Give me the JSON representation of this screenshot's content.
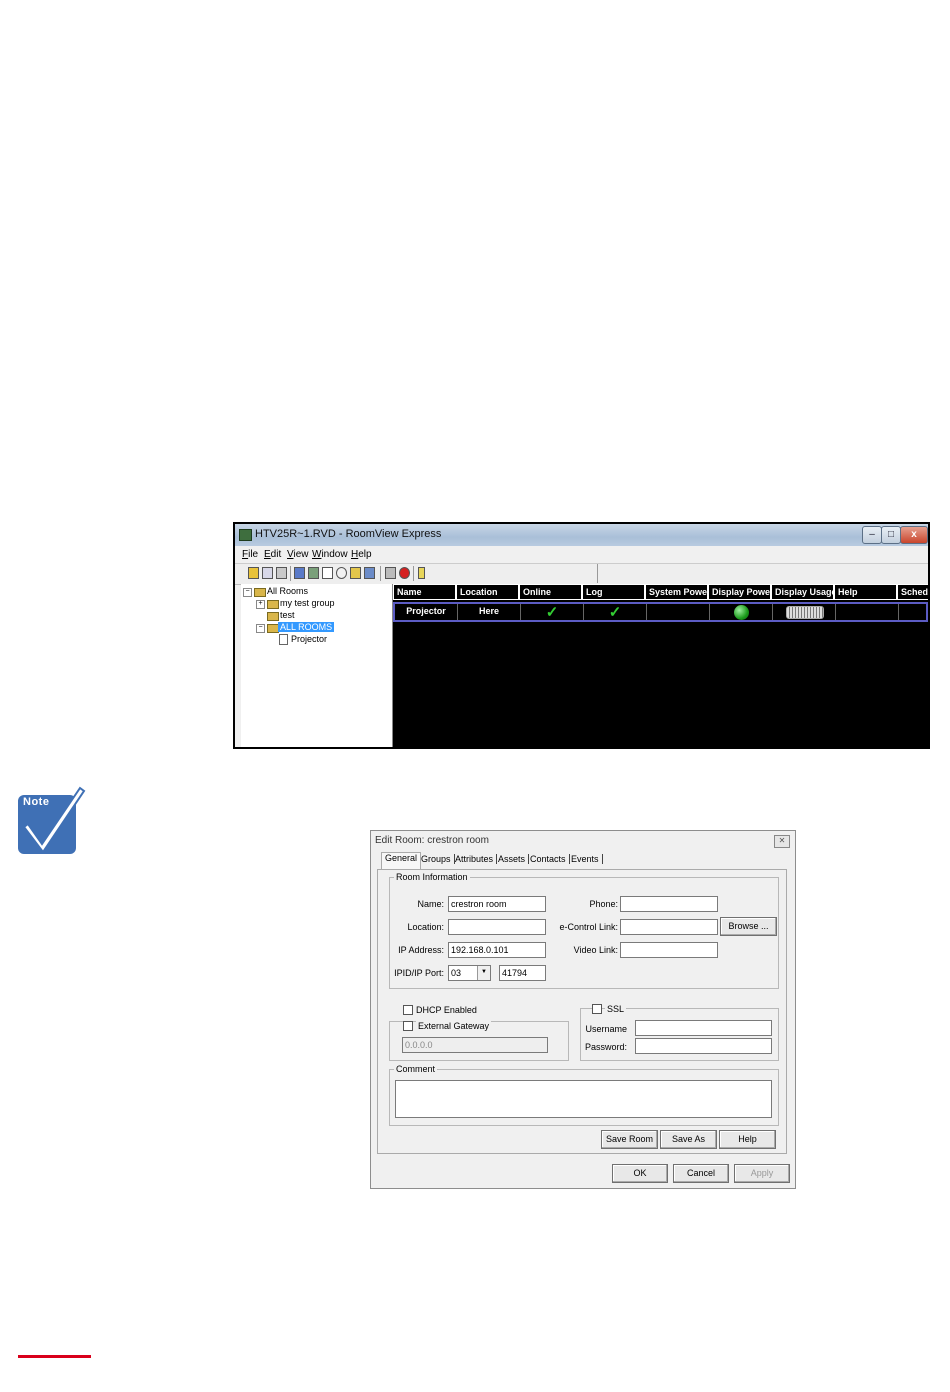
{
  "roomview": {
    "title": "HTV25R~1.RVD - RoomView Express",
    "menu": [
      "File",
      "Edit",
      "View",
      "Window",
      "Help"
    ],
    "tree": {
      "root": "All Rooms",
      "items": [
        "my test group",
        "test",
        "ALL ROOMS"
      ],
      "child": "Projector"
    },
    "columns": [
      "Name",
      "Location",
      "Online",
      "Log",
      "System Power",
      "Display Power",
      "Display Usage",
      "Help",
      "Sched"
    ],
    "row": {
      "name": "Projector",
      "location": "Here",
      "online": "✓",
      "log": "✓"
    },
    "toolbar_icons": [
      "new-icon",
      "find-icon",
      "print-icon",
      "connect-icon",
      "log-icon",
      "email-icon",
      "schedule-icon",
      "lock-icon",
      "alarm-icon",
      "tile-icon",
      "stop-icon",
      "help-icon"
    ],
    "colors": {
      "grid_bg": "#000000",
      "selected_border": "#5c5cc4",
      "check": "#33cc33",
      "tree_select": "#3399ff"
    }
  },
  "note": {
    "label": "Note",
    "color": "#3f70b5"
  },
  "dialog": {
    "title": "Edit Room: crestron room",
    "tabs": [
      "General",
      "Groups",
      "Attributes",
      "Assets",
      "Contacts",
      "Events"
    ],
    "room_info_legend": "Room Information",
    "labels": {
      "name": "Name:",
      "location": "Location:",
      "ip_address": "IP Address:",
      "ipid_port": "IPID/IP Port:",
      "phone": "Phone:",
      "econtrol": "e-Control Link:",
      "video": "Video Link:",
      "dhcp": "DHCP Enabled",
      "external_gateway": "External Gateway",
      "ssl": "SSL",
      "username": "Username",
      "password": "Password:",
      "comment": "Comment"
    },
    "values": {
      "name": "crestron room",
      "location": "",
      "ip_address": "192.168.0.101",
      "ipid": "03",
      "port": "41794",
      "phone": "",
      "econtrol": "",
      "video": "",
      "gateway": "0.0.0.0"
    },
    "buttons": {
      "browse": "Browse ...",
      "save_room": "Save Room",
      "save_as": "Save As",
      "help": "Help",
      "ok": "OK",
      "cancel": "Cancel",
      "apply": "Apply"
    }
  }
}
